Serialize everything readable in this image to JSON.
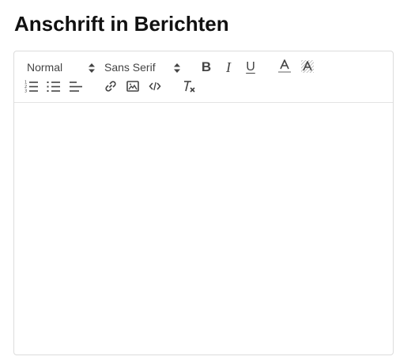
{
  "page": {
    "title": "Anschrift in Berichten"
  },
  "toolbar": {
    "size_picker": {
      "value": "Normal"
    },
    "font_picker": {
      "value": "Sans Serif"
    },
    "bold_label": "B",
    "italic_label": "I",
    "underline_label": "U",
    "icons": [
      "chevron-updown-icon",
      "bold-icon",
      "italic-icon",
      "underline-icon",
      "text-color-icon",
      "background-color-icon",
      "ordered-list-icon",
      "bullet-list-icon",
      "align-icon",
      "link-icon",
      "image-icon",
      "code-icon",
      "clear-format-icon"
    ]
  },
  "editor": {
    "content": ""
  },
  "colors": {
    "icon": "#444444",
    "border": "#dcdcdc",
    "title": "#111111"
  }
}
